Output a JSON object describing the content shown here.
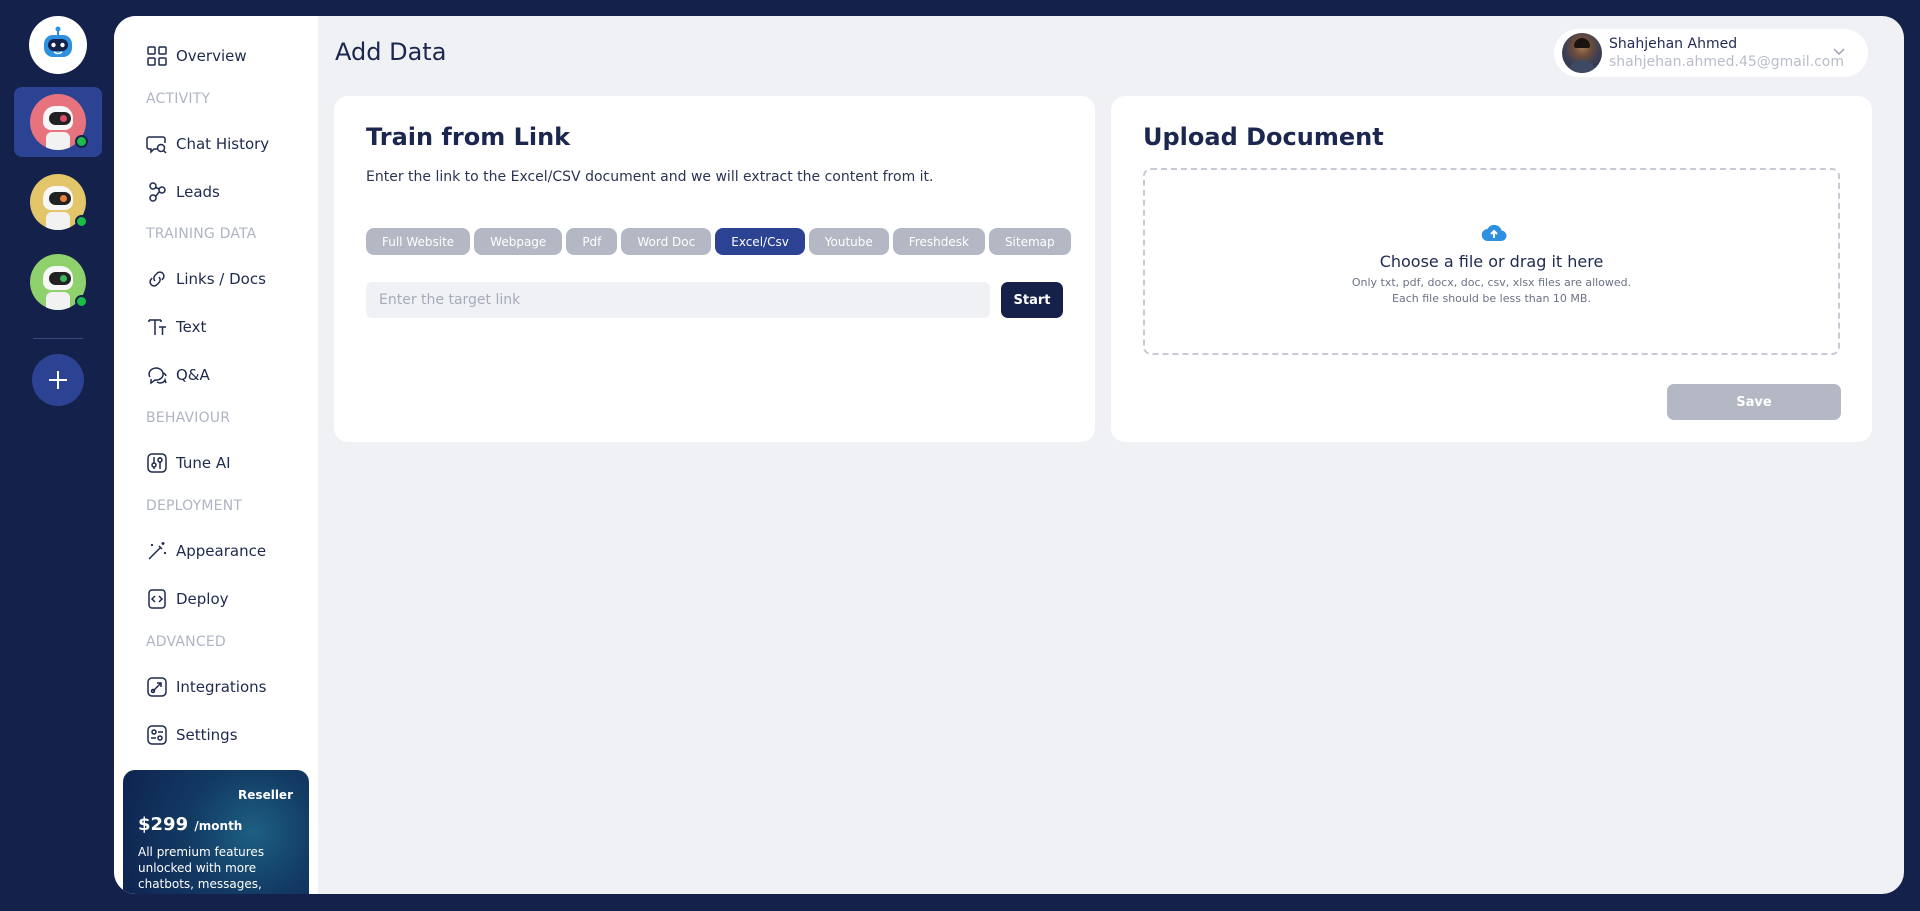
{
  "bots": [
    {
      "name": "bot-1",
      "color": "#e7737e",
      "online": true,
      "active": true
    },
    {
      "name": "bot-2",
      "color": "#e3c56a",
      "online": true,
      "active": false
    },
    {
      "name": "bot-3",
      "color": "#8fd16c",
      "online": true,
      "active": false
    }
  ],
  "sidebar": {
    "overview": "Overview",
    "sections": {
      "activity": "ACTIVITY",
      "training": "TRAINING DATA",
      "behaviour": "BEHAVIOUR",
      "deployment": "DEPLOYMENT",
      "advanced": "ADVANCED"
    },
    "items": {
      "chat_history": "Chat History",
      "leads": "Leads",
      "links_docs": "Links / Docs",
      "text": "Text",
      "qa": "Q&A",
      "tune_ai": "Tune AI",
      "appearance": "Appearance",
      "deploy": "Deploy",
      "integrations": "Integrations",
      "settings": "Settings"
    },
    "promo": {
      "tag": "Reseller",
      "price": "$299",
      "period": "/month",
      "description": "All premium features unlocked with more chatbots, messages, and"
    }
  },
  "header": {
    "title": "Add Data",
    "user": {
      "name": "Shahjehan Ahmed",
      "email": "shahjehan.ahmed.45@gmail.com"
    }
  },
  "train_link": {
    "title": "Train from Link",
    "description": "Enter the link to the Excel/CSV document and we will extract the content from it.",
    "chips": [
      "Full Website",
      "Webpage",
      "Pdf",
      "Word Doc",
      "Excel/Csv",
      "Youtube",
      "Freshdesk",
      "Sitemap"
    ],
    "active_chip": "Excel/Csv",
    "input_placeholder": "Enter the target link",
    "input_value": "",
    "start_label": "Start"
  },
  "upload": {
    "title": "Upload Document",
    "drop_title": "Choose a file or drag it here",
    "drop_allowed": "Only txt, pdf, docx, doc, csv, xlsx files are allowed.",
    "drop_size": "Each file should be less than 10 MB.",
    "save_label": "Save"
  },
  "colors": {
    "background": "#14214b",
    "accent": "#2c4394",
    "surface": "#eff1f5",
    "online": "#1cbc4b",
    "upload_icon": "#2f8fe0"
  }
}
